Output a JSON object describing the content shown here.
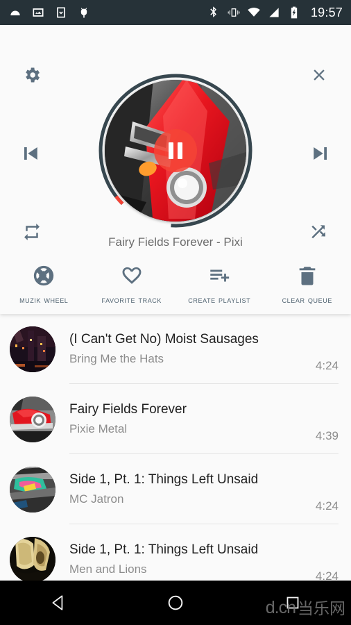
{
  "statusbar": {
    "clock": "19:57",
    "left_icons": [
      "android-icon",
      "image-icon",
      "download-icon",
      "bug-icon"
    ],
    "right_icons": [
      "bluetooth-icon",
      "vibrate-icon",
      "wifi-icon",
      "cell-signal-icon",
      "battery-charging-icon"
    ]
  },
  "player": {
    "settings_icon": "gear-icon",
    "close_icon": "close-icon",
    "previous_icon": "skip-previous-icon",
    "next_icon": "skip-next-icon",
    "repeat_icon": "repeat-icon",
    "shuffle_icon": "shuffle-icon",
    "playpause_icon": "pause-icon",
    "playpause_state": "playing",
    "now_playing": "Fairy Fields Forever - Pixi",
    "progress_percent": 2,
    "album_art": "red-classic-car",
    "colors": {
      "accent": "#f44336",
      "ring": "#37474f",
      "icon": "#5d7080",
      "background": "#fafafa"
    }
  },
  "actions": [
    {
      "icon": "muzik-wheel-icon",
      "label": "Muzik Wheel"
    },
    {
      "icon": "heart-icon",
      "label": "Favorite Track"
    },
    {
      "icon": "playlist-add-icon",
      "label": "Create Playlist"
    },
    {
      "icon": "trash-icon",
      "label": "Clear Queue"
    }
  ],
  "queue": [
    {
      "title": "(I Can't Get No) Moist Sausages",
      "artist": "Bring Me the Hats",
      "duration": "4:24",
      "artwork": "night-city"
    },
    {
      "title": "Fairy Fields Forever",
      "artist": "Pixie Metal",
      "duration": "4:39",
      "artwork": "red-car"
    },
    {
      "title": "Side 1, Pt. 1: Things Left Unsaid",
      "artist": "MC Jatron",
      "duration": "4:24",
      "artwork": "graffiti-wall"
    },
    {
      "title": "Side 1, Pt. 1: Things Left Unsaid",
      "artist": "Men and Lions",
      "duration": "4:24",
      "artwork": "sepia-stone"
    }
  ],
  "navbar": {
    "back_icon": "back-triangle-icon",
    "home_icon": "home-circle-icon",
    "recents_icon": "recents-square-icon",
    "watermark": "d.cn",
    "watermark_cn": "当乐网"
  }
}
